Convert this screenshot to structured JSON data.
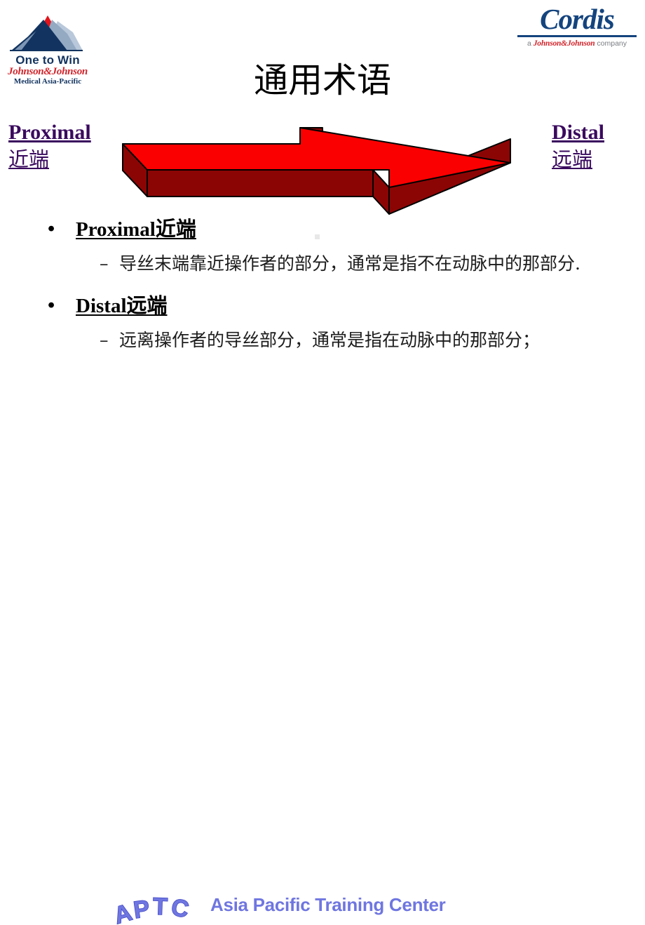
{
  "slide": {
    "title": "通用术语",
    "background": "#ffffff"
  },
  "logos": {
    "jj": {
      "tagline": "One to Win",
      "company": "Johnson&Johnson",
      "division": "Medical Asia-Pacific",
      "peak_color": "#e3131b",
      "mountain_color": "#12335f"
    },
    "cordis": {
      "wordmark": "Cordis",
      "tagline_prefix": "a ",
      "tagline_brand": "Johnson&Johnson",
      "tagline_suffix": " company",
      "color": "#14447e",
      "brand_color": "#d1242b"
    }
  },
  "diagram": {
    "left_label": {
      "en": "Proximal",
      "cn": "近端"
    },
    "right_label": {
      "en": "Distal",
      "cn": "远端"
    },
    "label_color": "#3a0a5e",
    "arrow": {
      "name": "right-pointing-3d-arrow",
      "direction": "right",
      "top_face_color": "#fb0000",
      "side_face_color": "#8c0505",
      "outline_color": "#000000"
    }
  },
  "body": {
    "bullets": [
      {
        "heading_en": "Proximal",
        "heading_cn": "近端",
        "detail": "导丝末端靠近操作者的部分，通常是指不在动脉中的那部分.",
        "dash": "–",
        "dot": "•"
      },
      {
        "heading_en": "Distal",
        "heading_cn": "远端",
        "detail": "远离操作者的导丝部分，通常是指在动脉中的那部分；",
        "dash": "–",
        "dot": "•"
      }
    ]
  },
  "footer": {
    "acronym": "APTC",
    "acronym_letters": [
      "A",
      "P",
      "T",
      "C"
    ],
    "label": "Asia Pacific Training Center",
    "color": "#6f76e0",
    "outline_color": "#3b42c4"
  }
}
